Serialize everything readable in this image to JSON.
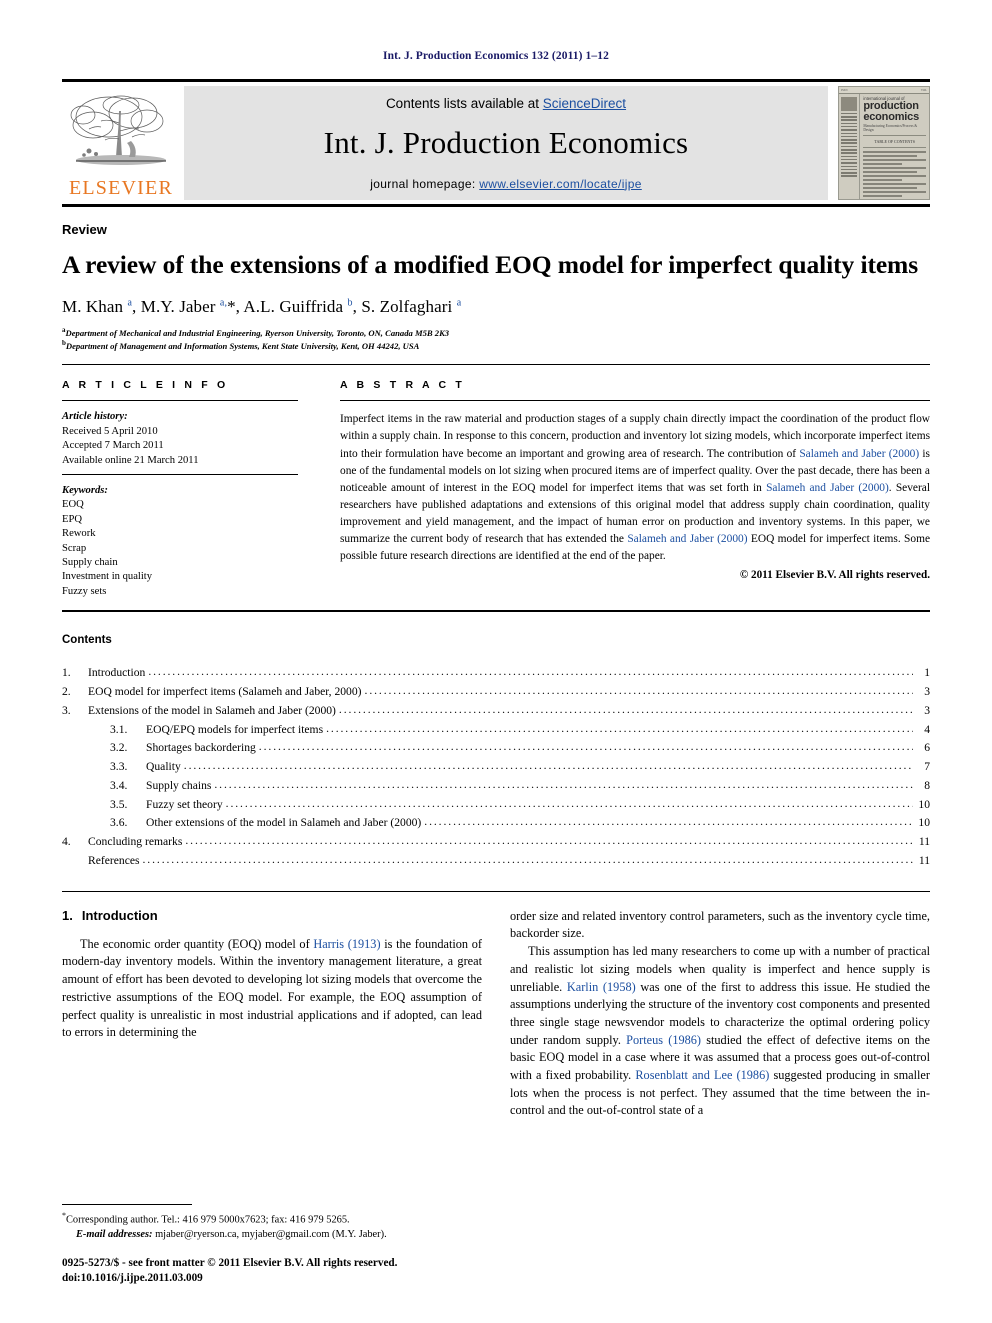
{
  "running_head": "Int. J. Production Economics 132 (2011) 1–12",
  "masthead": {
    "contents_prefix": "Contents lists available at ",
    "sciencedirect": "ScienceDirect",
    "journal_title": "Int. J. Production Economics",
    "homepage_prefix": "journal homepage: ",
    "homepage_url": "www.elsevier.com/locate/ijpe",
    "publisher": "ELSEVIER",
    "cover": {
      "small_top": "international journal of",
      "big_line1": "production",
      "big_line2": "economics",
      "sub": "Manufacturing Economics/Process & Design",
      "center_note": "TABLE OF CONTENTS"
    },
    "accent_orange": "#E87722",
    "link_blue": "#1c4fa0"
  },
  "article": {
    "doctype": "Review",
    "title": "A review of the extensions of a modified EOQ model for imperfect quality items",
    "authors_html": "M. Khan <sup>a</sup>, M.Y. Jaber <sup>a,</sup>*, A.L. Guiffrida <sup>b</sup>, S. Zolfaghari <sup>a</sup>",
    "affiliations": [
      {
        "marker": "a",
        "text": "Department of Mechanical and Industrial Engineering, Ryerson University, Toronto, ON, Canada M5B 2K3"
      },
      {
        "marker": "b",
        "text": "Department of Management and Information Systems, Kent State University, Kent, OH 44242, USA"
      }
    ]
  },
  "article_info": {
    "heading": "A R T I C L E   I N F O",
    "history_label": "Article history:",
    "history": [
      "Received 5 April 2010",
      "Accepted 7 March 2011",
      "Available online 21 March 2011"
    ],
    "keywords_label": "Keywords:",
    "keywords": [
      "EOQ",
      "EPQ",
      "Rework",
      "Scrap",
      "Supply chain",
      "Investment in quality",
      "Fuzzy sets"
    ]
  },
  "abstract": {
    "heading": "A B S T R A C T",
    "paragraph_parts": [
      {
        "t": "Imperfect items in the raw material and production stages of a supply chain directly impact the coordination of the product flow within a supply chain. In response to this concern, production and inventory lot sizing models, which incorporate imperfect items into their formulation have become an important and growing area of research. The contribution of ",
        "ref": false
      },
      {
        "t": "Salameh and Jaber (2000)",
        "ref": true
      },
      {
        "t": " is one of the fundamental models on lot sizing when procured items are of imperfect quality. Over the past decade, there has been a noticeable amount of interest in the EOQ model for imperfect items that was set forth in ",
        "ref": false
      },
      {
        "t": "Salameh and Jaber (2000)",
        "ref": true
      },
      {
        "t": ". Several researchers have published adaptations and extensions of this original model that address supply chain coordination, quality improvement and yield management, and the impact of human error on production and inventory systems. In this paper, we summarize the current body of research that has extended the ",
        "ref": false
      },
      {
        "t": "Salameh and Jaber (2000)",
        "ref": true
      },
      {
        "t": " EOQ model for imperfect items. Some possible future research directions are identified at the end of the paper.",
        "ref": false
      }
    ],
    "copyright": "© 2011 Elsevier B.V. All rights reserved."
  },
  "contents": {
    "heading": "Contents",
    "items": [
      {
        "num": "1.",
        "label": "Introduction",
        "page": "1",
        "level": 1
      },
      {
        "num": "2.",
        "label": "EOQ model for imperfect items (Salameh and Jaber, 2000)",
        "page": "3",
        "level": 1
      },
      {
        "num": "3.",
        "label": "Extensions of the model in Salameh and Jaber (2000)",
        "page": "3",
        "level": 1
      },
      {
        "num": "3.1.",
        "label": "EOQ/EPQ models for imperfect items",
        "page": "4",
        "level": 2
      },
      {
        "num": "3.2.",
        "label": "Shortages backordering",
        "page": "6",
        "level": 2
      },
      {
        "num": "3.3.",
        "label": "Quality",
        "page": "7",
        "level": 2
      },
      {
        "num": "3.4.",
        "label": "Supply chains",
        "page": "8",
        "level": 2
      },
      {
        "num": "3.5.",
        "label": "Fuzzy set theory",
        "page": "10",
        "level": 2
      },
      {
        "num": "3.6.",
        "label": "Other extensions of the model in Salameh and Jaber (2000)",
        "page": "10",
        "level": 2
      },
      {
        "num": "4.",
        "label": "Concluding remarks",
        "page": "11",
        "level": 1
      },
      {
        "num": "",
        "label": "References",
        "page": "11",
        "level": 1
      }
    ]
  },
  "introduction": {
    "heading_num": "1.",
    "heading_label": "Introduction",
    "left_paragraph_parts": [
      {
        "t": "The economic order quantity (EOQ) model of ",
        "ref": false
      },
      {
        "t": "Harris (1913)",
        "ref": true
      },
      {
        "t": " is the foundation of modern-day inventory models. Within the inventory management literature, a great amount of effort has been devoted to developing lot sizing models that overcome the restrictive assumptions of the EOQ model. For example, the EOQ assumption of perfect quality is unrealistic in most industrial applications and if adopted, can lead to errors in determining the",
        "ref": false
      }
    ],
    "right_paragraph1_parts": [
      {
        "t": "order size and related inventory control parameters, such as the inventory cycle time, backorder size.",
        "ref": false
      }
    ],
    "right_paragraph2_parts": [
      {
        "t": "This assumption has led many researchers to come up with a number of practical and realistic lot sizing models when quality is imperfect and hence supply is unreliable. ",
        "ref": false
      },
      {
        "t": "Karlin (1958)",
        "ref": true
      },
      {
        "t": " was one of the first to address this issue. He studied the assumptions underlying the structure of the inventory cost components and presented three single stage newsvendor models to characterize the optimal ordering policy under random supply. ",
        "ref": false
      },
      {
        "t": "Porteus (1986)",
        "ref": true
      },
      {
        "t": " studied the effect of defective items on the basic EOQ model in a case where it was assumed that a process goes out-of-control with a fixed probability. ",
        "ref": false
      },
      {
        "t": "Rosenblatt and Lee (1986)",
        "ref": true
      },
      {
        "t": " suggested producing in smaller lots when the process is not perfect. They assumed that the time between the in-control and the out-of-control state of a",
        "ref": false
      }
    ]
  },
  "footnote": {
    "corresponding": "Corresponding author. Tel.: 416 979 5000x7623; fax: 416 979 5265.",
    "email_label": "E-mail addresses:",
    "emails": "mjaber@ryerson.ca, myjaber@gmail.com (M.Y. Jaber).",
    "imprint_line1": "0925-5273/$ - see front matter © 2011 Elsevier B.V. All rights reserved.",
    "imprint_line2": "doi:10.1016/j.ijpe.2011.03.009"
  }
}
